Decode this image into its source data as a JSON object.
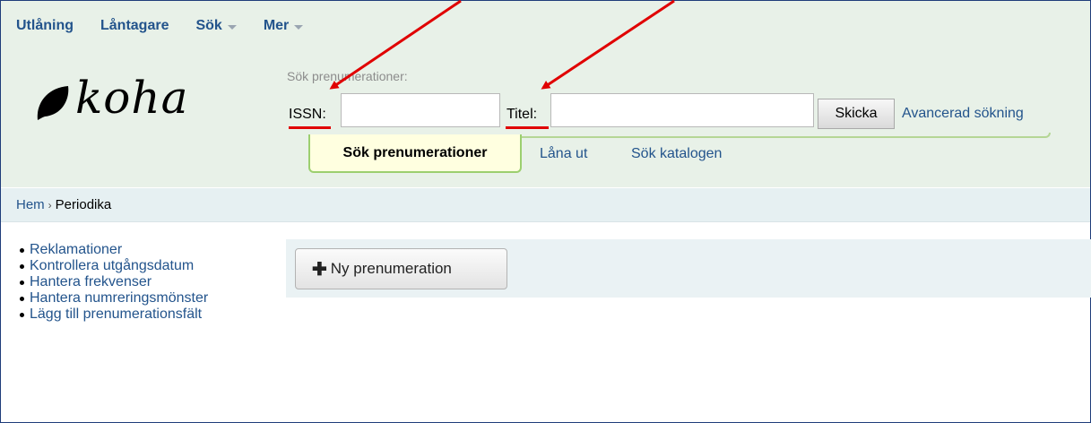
{
  "topnav": {
    "items": [
      {
        "label": "Utlåning"
      },
      {
        "label": "Låntagare"
      },
      {
        "label": "Sök",
        "dropdown": true
      },
      {
        "label": "Mer",
        "dropdown": true
      }
    ]
  },
  "logo": {
    "text": "koha"
  },
  "search": {
    "heading": "Sök prenumerationer:",
    "issn_label": "ISSN:",
    "issn_value": "",
    "title_label": "Titel:",
    "title_value": "",
    "submit_label": "Skicka",
    "advanced_label": "Avancerad sökning"
  },
  "tabs": [
    {
      "label": "Sök prenumerationer",
      "active": true
    },
    {
      "label": "Låna ut"
    },
    {
      "label": "Sök katalogen"
    }
  ],
  "breadcrumb": {
    "home": "Hem",
    "separator": "›",
    "current": "Periodika"
  },
  "sidebar": {
    "items": [
      {
        "label": "Reklamationer"
      },
      {
        "label": "Kontrollera utgångsdatum"
      },
      {
        "label": "Hantera frekvenser"
      },
      {
        "label": "Hantera numreringsmönster"
      },
      {
        "label": "Lägg till prenumerationsfält"
      }
    ]
  },
  "toolbar": {
    "new_subscription_label": "Ny prenumeration",
    "icon": "plus-icon"
  },
  "colors": {
    "link": "#23548c",
    "header_bg": "#e8f1e8",
    "active_tab_bg": "#ffffe0",
    "annotation_red": "#e00000"
  }
}
